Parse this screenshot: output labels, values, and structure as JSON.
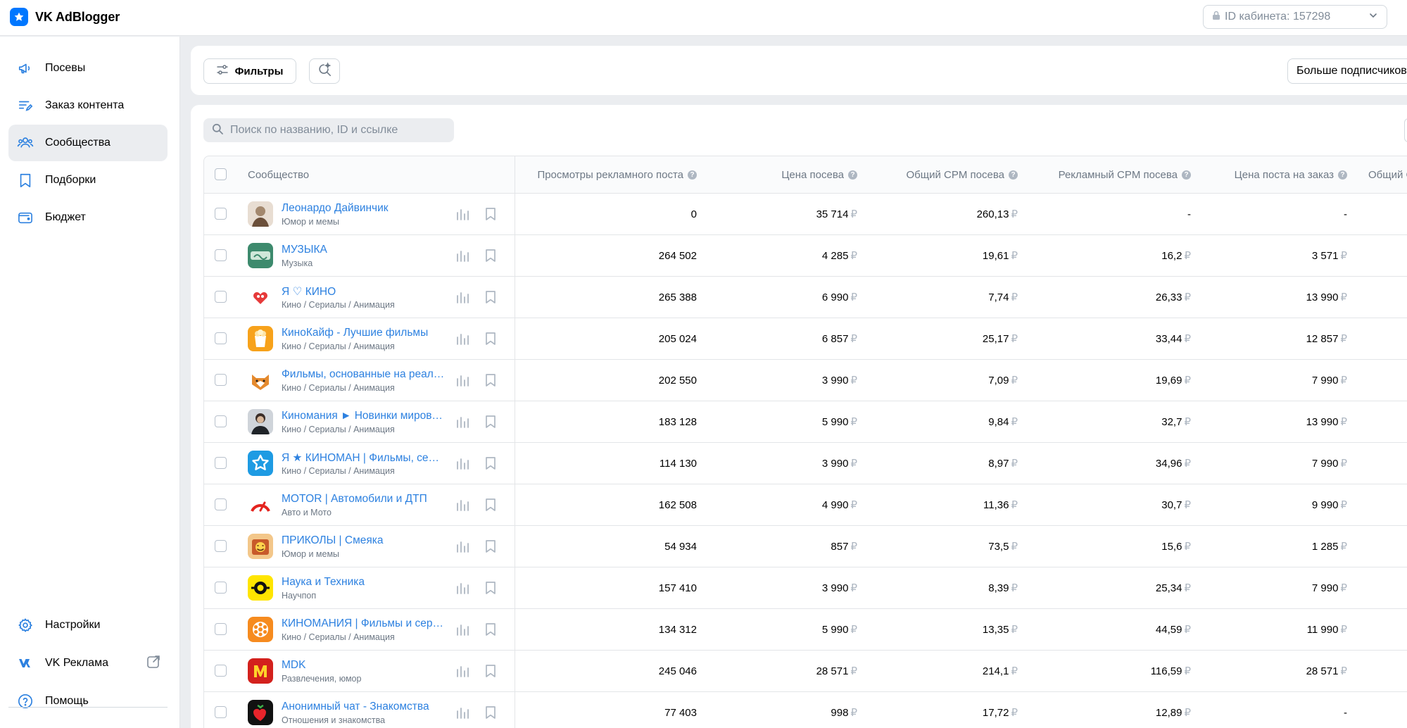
{
  "app": {
    "title": "VK AdBlogger"
  },
  "cabinet": {
    "label": "ID кабинета: 157298"
  },
  "sidebar": {
    "items": [
      {
        "label": "Посевы",
        "icon": "megaphone-icon"
      },
      {
        "label": "Заказ контента",
        "icon": "edit-list-icon"
      },
      {
        "label": "Сообщества",
        "icon": "users-icon"
      },
      {
        "label": "Подборки",
        "icon": "bookmark-icon"
      },
      {
        "label": "Бюджет",
        "icon": "wallet-icon"
      }
    ],
    "bottom": [
      {
        "label": "Настройки",
        "icon": "gear-icon"
      },
      {
        "label": "VK Реклама",
        "icon": "vk-ads-icon"
      },
      {
        "label": "Помощь",
        "icon": "help-icon"
      }
    ]
  },
  "toolbar": {
    "filters_label": "Фильтры",
    "sort_label": "Больше подписчиков"
  },
  "search": {
    "placeholder": "Поиск по названию, ID и ссылке"
  },
  "table": {
    "headers": {
      "community": "Сообщество",
      "views": "Просмотры рекламного поста",
      "price": "Цена посева",
      "cpm": "Общий CPM посева",
      "adcpm": "Рекламный CPM посева",
      "order": "Цена поста на заказ",
      "cpm2": "Общий CPM"
    },
    "currency": "₽",
    "rows": [
      {
        "name": "Леонардо Дайвинчик",
        "category": "Юмор и мемы",
        "views": "0",
        "price": "35 714",
        "cpm": "260,13",
        "adcpm": "-",
        "order": "-"
      },
      {
        "name": "МУЗЫКА",
        "category": "Музыка",
        "views": "264 502",
        "price": "4 285",
        "cpm": "19,61",
        "adcpm": "16,2",
        "order": "3 571"
      },
      {
        "name": "Я ♡ КИНО",
        "category": "Кино / Сериалы / Анимация",
        "views": "265 388",
        "price": "6 990",
        "cpm": "7,74",
        "adcpm": "26,33",
        "order": "13 990"
      },
      {
        "name": "КиноКайф - Лучшие фильмы",
        "category": "Кино / Сериалы / Анимация",
        "views": "205 024",
        "price": "6 857",
        "cpm": "25,17",
        "adcpm": "33,44",
        "order": "12 857"
      },
      {
        "name": "Фильмы, основанные на реальных событиях",
        "category": "Кино / Сериалы / Анимация",
        "views": "202 550",
        "price": "3 990",
        "cpm": "7,09",
        "adcpm": "19,69",
        "order": "7 990"
      },
      {
        "name": "Киномания ► Новинки мирового кино",
        "category": "Кино / Сериалы / Анимация",
        "views": "183 128",
        "price": "5 990",
        "cpm": "9,84",
        "adcpm": "32,7",
        "order": "13 990"
      },
      {
        "name": "Я ★ КИНОМАН | Фильмы, сериалы",
        "category": "Кино / Сериалы / Анимация",
        "views": "114 130",
        "price": "3 990",
        "cpm": "8,97",
        "adcpm": "34,96",
        "order": "7 990"
      },
      {
        "name": "MOTOR | Автомобили и ДТП",
        "category": "Авто и Мото",
        "views": "162 508",
        "price": "4 990",
        "cpm": "11,36",
        "adcpm": "30,7",
        "order": "9 990"
      },
      {
        "name": "ПРИКОЛЫ | Смеяка",
        "category": "Юмор и мемы",
        "views": "54 934",
        "price": "857",
        "cpm": "73,5",
        "adcpm": "15,6",
        "order": "1 285"
      },
      {
        "name": "Наука и Техника",
        "category": "Научпоп",
        "views": "157 410",
        "price": "3 990",
        "cpm": "8,39",
        "adcpm": "25,34",
        "order": "7 990"
      },
      {
        "name": "КИНОМАНИЯ | Фильмы и сериалы",
        "category": "Кино / Сериалы / Анимация",
        "views": "134 312",
        "price": "5 990",
        "cpm": "13,35",
        "adcpm": "44,59",
        "order": "11 990"
      },
      {
        "name": "MDK",
        "category": "Развлечения, юмор",
        "views": "245 046",
        "price": "28 571",
        "cpm": "214,1",
        "adcpm": "116,59",
        "order": "28 571"
      },
      {
        "name": "Анонимный чат - Знакомства",
        "category": "Отношения и знакомства",
        "views": "77 403",
        "price": "998",
        "cpm": "17,72",
        "adcpm": "12,89",
        "order": "-"
      }
    ]
  },
  "colors": {
    "accent": "#0077ff",
    "link": "#2d81e0",
    "muted": "#6d7885",
    "bg": "#ebedf0"
  }
}
